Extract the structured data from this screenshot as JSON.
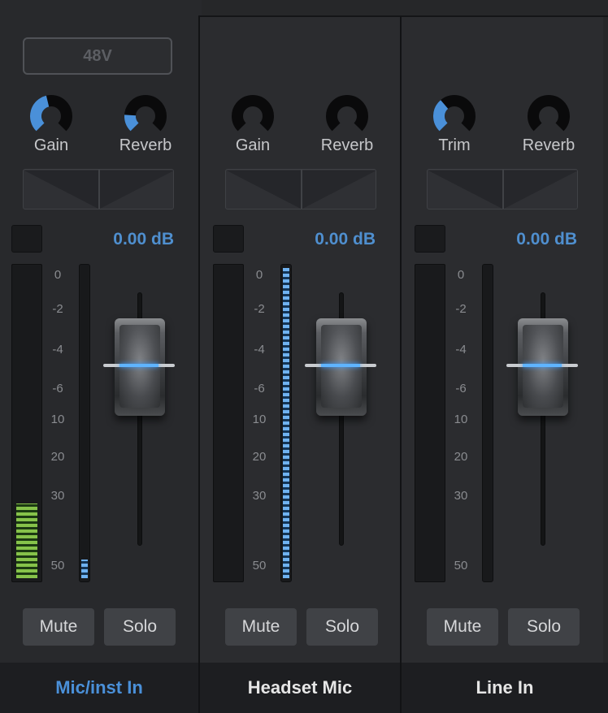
{
  "channels": [
    {
      "phantom_label": "48V",
      "knob1": {
        "label": "Gain",
        "level": 0.45
      },
      "knob2": {
        "label": "Reverb",
        "level": 0.18
      },
      "gain_readout": "0.00 dB",
      "meter_level": 0.24,
      "thin_meter_level": 0.06,
      "mute_label": "Mute",
      "solo_label": "Solo",
      "name": "Mic/inst In",
      "name_color": "#4a90d9"
    },
    {
      "knob1": {
        "label": "Gain",
        "level": 0
      },
      "knob2": {
        "label": "Reverb",
        "level": 0
      },
      "gain_readout": "0.00 dB",
      "meter_level": 0,
      "thin_meter_level": 1.0,
      "mute_label": "Mute",
      "solo_label": "Solo",
      "name": "Headset Mic",
      "name_color": "#e6e6e6"
    },
    {
      "knob1": {
        "label": "Trim",
        "level": 0.35
      },
      "knob2": {
        "label": "Reverb",
        "level": 0
      },
      "gain_readout": "0.00 dB",
      "meter_level": 0,
      "thin_meter_level": 0,
      "mute_label": "Mute",
      "solo_label": "Solo",
      "name": "Line In",
      "name_color": "#e6e6e6"
    }
  ],
  "scale_labels": [
    "0",
    "-2",
    "-4",
    "-6",
    "10",
    "20",
    "30",
    "50"
  ],
  "colors": {
    "accent": "#4a90d9",
    "meter_green": "#86c24a",
    "meter_blue": "#6fb2f0"
  }
}
